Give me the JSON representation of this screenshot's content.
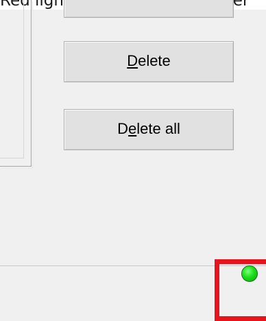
{
  "caption": {
    "text": "Red light in bottom right corner"
  },
  "buttons": {
    "delete": {
      "mnemonic_before": "",
      "mnemonic_char": "D",
      "mnemonic_after": "elete"
    },
    "delete_all": {
      "mnemonic_before": "D",
      "mnemonic_char": "e",
      "mnemonic_after": "lete all"
    }
  },
  "status": {
    "indicator_color": "#19e019",
    "highlight_color": "#e8141d"
  }
}
